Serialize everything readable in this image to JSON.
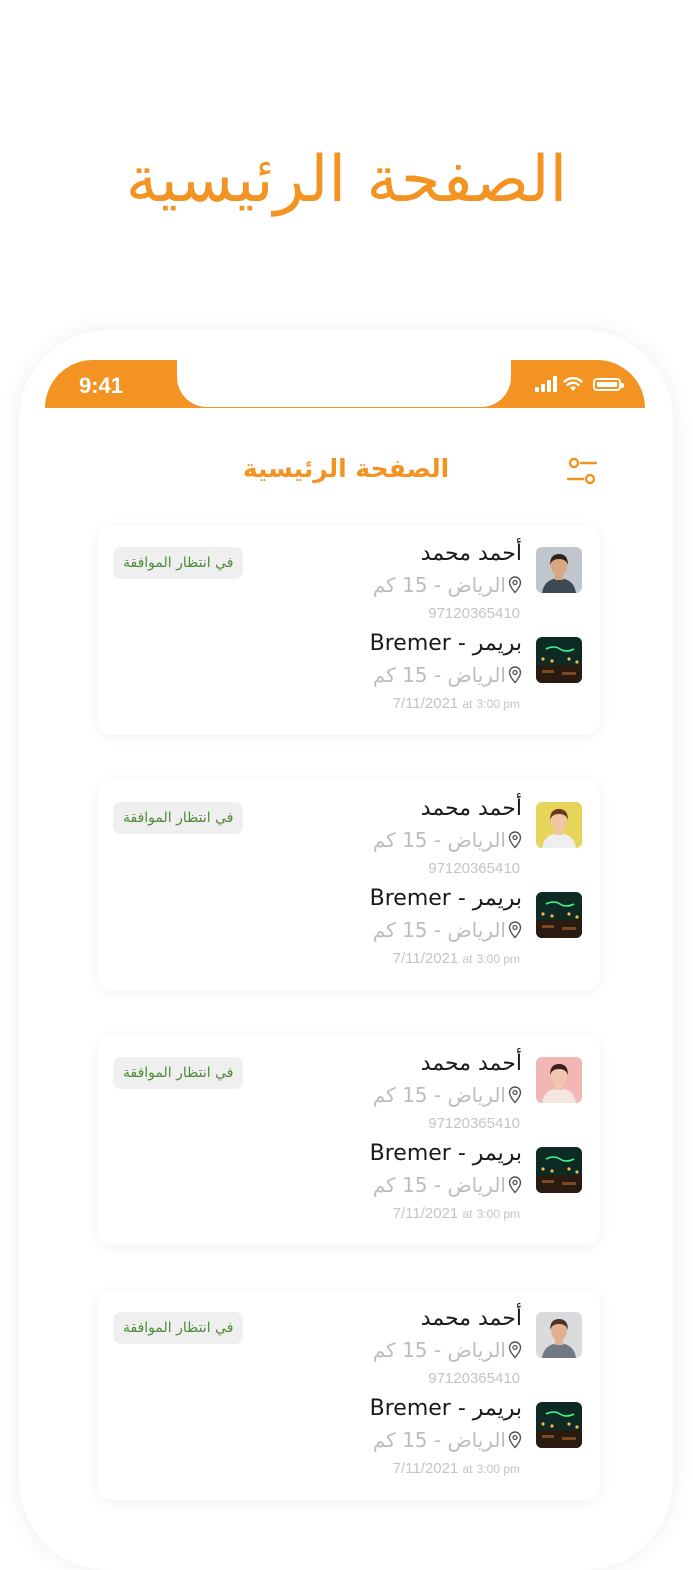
{
  "hero": {
    "title": "الصفحة الرئيسية"
  },
  "statusbar": {
    "time": "9:41"
  },
  "header": {
    "title": "الصفحة الرئيسية"
  },
  "colors": {
    "accent": "#F39322",
    "badge_text": "#4E8B3A",
    "badge_bg": "#EFEFEF",
    "muted": "#BDBDBD"
  },
  "icons": {
    "filter": "sliders-filter-icon",
    "signal": "signal-bars-icon",
    "wifi": "wifi-icon",
    "battery": "battery-icon",
    "pin": "location-pin-icon"
  },
  "requests": [
    {
      "status": "في انتظار الموافقة",
      "user": {
        "name": "أحمد محمد",
        "location": "الرياض - 15 كم",
        "phone": "97120365410"
      },
      "venue": {
        "name": "بريمر - Bremer",
        "location": "الرياض - 15 كم",
        "date": "7/11/2021",
        "at": "at",
        "time": "3:00 pm"
      }
    },
    {
      "status": "في انتظار الموافقة",
      "user": {
        "name": "أحمد محمد",
        "location": "الرياض - 15 كم",
        "phone": "97120365410"
      },
      "venue": {
        "name": "بريمر - Bremer",
        "location": "الرياض - 15 كم",
        "date": "7/11/2021",
        "at": "at",
        "time": "3:00 pm"
      }
    },
    {
      "status": "في انتظار الموافقة",
      "user": {
        "name": "أحمد محمد",
        "location": "الرياض - 15 كم",
        "phone": "97120365410"
      },
      "venue": {
        "name": "بريمر - Bremer",
        "location": "الرياض - 15 كم",
        "date": "7/11/2021",
        "at": "at",
        "time": "3:00 pm"
      }
    },
    {
      "status": "في انتظار الموافقة",
      "user": {
        "name": "أحمد محمد",
        "location": "الرياض - 15 كم",
        "phone": "97120365410"
      },
      "venue": {
        "name": "بريمر - Bremer",
        "location": "الرياض - 15 كم",
        "date": "7/11/2021",
        "at": "at",
        "time": "3:00 pm"
      }
    }
  ]
}
